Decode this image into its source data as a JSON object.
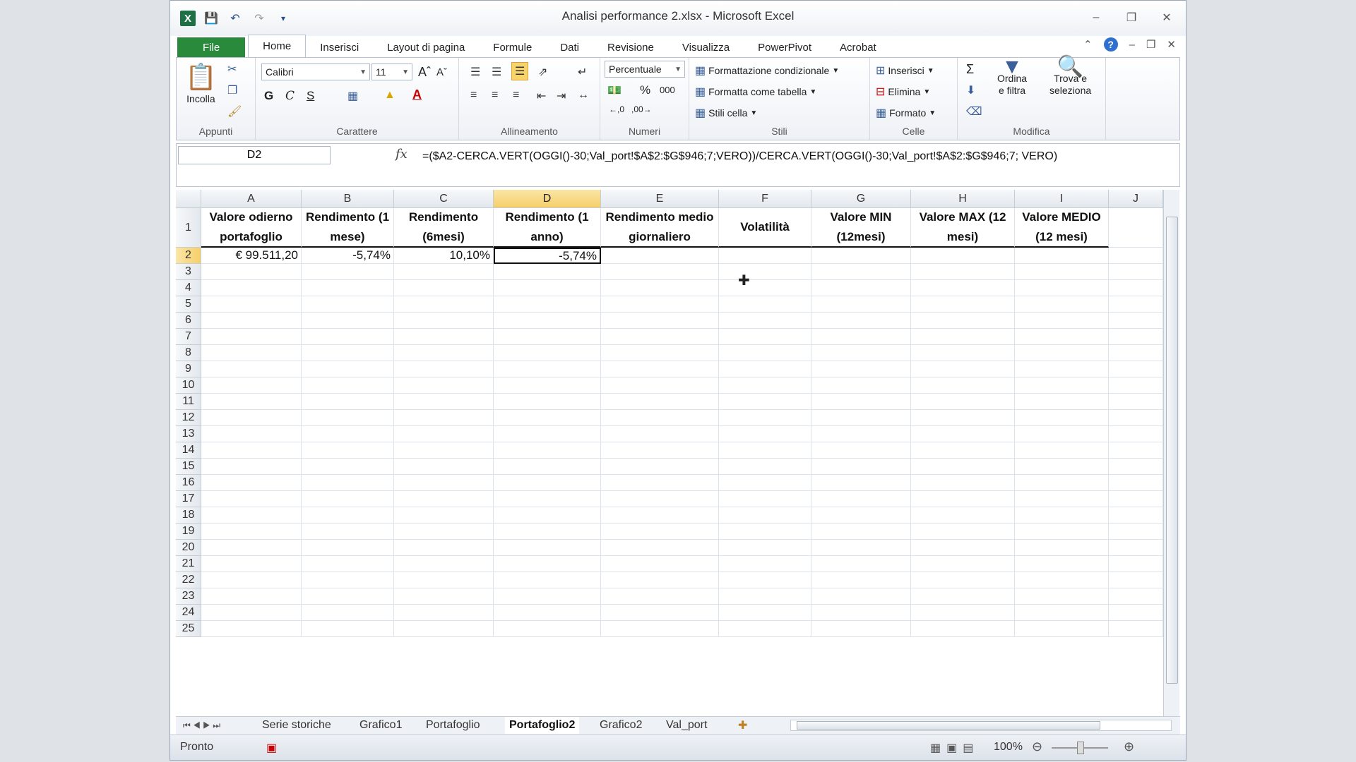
{
  "window": {
    "title": "Analisi performance 2.xlsx - Microsoft Excel"
  },
  "qat": {
    "logo": "X"
  },
  "tabs": [
    "File",
    "Home",
    "Inserisci",
    "Layout di pagina",
    "Formule",
    "Dati",
    "Revisione",
    "Visualizza",
    "PowerPivot",
    "Acrobat"
  ],
  "active_tab": "Home",
  "ribbon": {
    "appunti": {
      "label": "Appunti",
      "incolla": "Incolla"
    },
    "carattere": {
      "label": "Carattere",
      "font": "Calibri",
      "size": "11",
      "bold": "G",
      "italic": "C",
      "underline": "S"
    },
    "allineamento": {
      "label": "Allineamento"
    },
    "numeri": {
      "label": "Numeri",
      "format": "Percentuale",
      "percent": "%",
      "thousands": "000"
    },
    "stili": {
      "label": "Stili",
      "cond": "Formattazione condizionale",
      "table": "Formatta come tabella",
      "cell": "Stili cella"
    },
    "celle": {
      "label": "Celle",
      "insert": "Inserisci",
      "delete": "Elimina",
      "format": "Formato"
    },
    "modifica": {
      "label": "Modifica",
      "sort": "Ordina",
      "sort2": "e filtra",
      "find": "Trova e",
      "find2": "seleziona"
    }
  },
  "formula_bar": {
    "name_box": "D2",
    "fx": "fx",
    "formula": "=($A2-CERCA.VERT(OGGI()-30;Val_port!$A$2:$G$946;7;VERO))/CERCA.VERT(OGGI()-30;Val_port!$A$2:$G$946;7; VERO)"
  },
  "columns": [
    "A",
    "B",
    "C",
    "D",
    "E",
    "F",
    "G",
    "H",
    "I",
    "J"
  ],
  "rows": [
    "1",
    "2",
    "3",
    "4",
    "5",
    "6",
    "7",
    "8",
    "9",
    "10",
    "11",
    "12",
    "13",
    "14",
    "15",
    "16",
    "17",
    "18",
    "19",
    "20",
    "21",
    "22",
    "23",
    "24",
    "25"
  ],
  "headers": [
    "Valore odierno portafoglio",
    "Rendimento (1 mese)",
    "Rendimento (6mesi)",
    "Rendimento (1 anno)",
    "Rendimento medio giornaliero",
    "Volatilità",
    "Valore MIN (12mesi)",
    "Valore MAX (12 mesi)",
    "Valore MEDIO (12 mesi)"
  ],
  "row2": [
    "€ 99.511,20",
    "-5,74%",
    "10,10%",
    "-5,74%"
  ],
  "sheets": [
    "Serie storiche",
    "Grafico1",
    "Portafoglio",
    "Portafoglio2",
    "Grafico2",
    "Val_port"
  ],
  "active_sheet": "Portafoglio2",
  "status": {
    "ready": "Pronto",
    "zoom": "100%"
  }
}
